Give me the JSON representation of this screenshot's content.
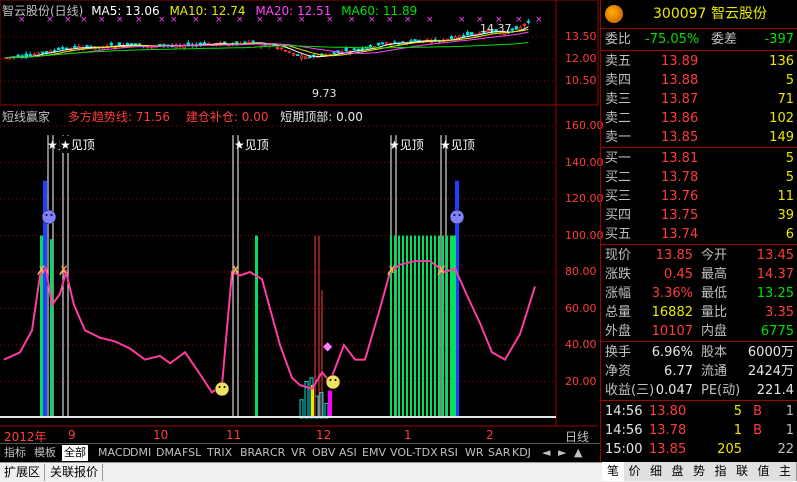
{
  "main_chart": {
    "title": "智云股份(日线)",
    "ma": [
      {
        "label": "MA5: 13.06",
        "color": "#ffffff"
      },
      {
        "label": "MA10: 12.74",
        "color": "#e8e800"
      },
      {
        "label": "MA20: 12.51",
        "color": "#ff44ff"
      },
      {
        "label": "MA60: 11.89",
        "color": "#00e000"
      }
    ],
    "y_ticks": [
      "13.50",
      "12.00",
      "10.50"
    ],
    "annotation_high": "14.37",
    "annotation_low": "9.73"
  },
  "indicator": {
    "name": "短线赢家",
    "lines": [
      {
        "label": "多方趋势线: 71.56",
        "color": "#ff3c3c"
      },
      {
        "label": "建仓补仓: 0.00",
        "color": "#ff3c3c"
      },
      {
        "label": "短期顶部: 0.00",
        "color": "#e6e6e6"
      }
    ],
    "y_ticks": [
      "160.00",
      "140.00",
      "120.00",
      "100.00",
      "80.00",
      "60.00",
      "40.00",
      "20.00"
    ],
    "top_labels": [
      "★见顶",
      "★见顶",
      "★见顶",
      "★见顶",
      "★见顶"
    ]
  },
  "time_axis": {
    "labels": [
      "2012年",
      "9",
      "10",
      "11",
      "12",
      "1",
      "2"
    ],
    "period": "日线"
  },
  "tabs": [
    "指标",
    "模板",
    "全部",
    "MACD",
    "DMI",
    "DMA",
    "FSL",
    "TRIX",
    "BRAR",
    "CR",
    "VR",
    "OBV",
    "ASI",
    "EMV",
    "VOL-TDX",
    "RSI",
    "WR",
    "SAR",
    "KDJ"
  ],
  "footer_tabs": [
    "扩展区",
    "关联报价"
  ],
  "quote": {
    "code": "300097",
    "name": "智云股份",
    "wei_bi_label": "委比",
    "wei_bi": "-75.05%",
    "wei_cha_label": "委差",
    "wei_cha": "-397",
    "asks": [
      {
        "label": "卖五",
        "price": "13.89",
        "vol": "136"
      },
      {
        "label": "卖四",
        "price": "13.88",
        "vol": "5"
      },
      {
        "label": "卖三",
        "price": "13.87",
        "vol": "71"
      },
      {
        "label": "卖二",
        "price": "13.86",
        "vol": "102"
      },
      {
        "label": "卖一",
        "price": "13.85",
        "vol": "149"
      }
    ],
    "bids": [
      {
        "label": "买一",
        "price": "13.81",
        "vol": "5"
      },
      {
        "label": "买二",
        "price": "13.78",
        "vol": "5"
      },
      {
        "label": "买三",
        "price": "13.76",
        "vol": "11"
      },
      {
        "label": "买四",
        "price": "13.75",
        "vol": "39"
      },
      {
        "label": "买五",
        "price": "13.74",
        "vol": "6"
      }
    ],
    "stats": [
      {
        "l1": "现价",
        "v1": "13.85",
        "c1": "red",
        "l2": "今开",
        "v2": "13.45",
        "c2": "red"
      },
      {
        "l1": "涨跌",
        "v1": "0.45",
        "c1": "red",
        "l2": "最高",
        "v2": "14.37",
        "c2": "red"
      },
      {
        "l1": "涨幅",
        "v1": "3.36%",
        "c1": "red",
        "l2": "最低",
        "v2": "13.25",
        "c2": "green"
      },
      {
        "l1": "总量",
        "v1": "16882",
        "c1": "yellow",
        "l2": "量比",
        "v2": "3.35",
        "c2": "red"
      },
      {
        "l1": "外盘",
        "v1": "10107",
        "c1": "red",
        "l2": "内盘",
        "v2": "6775",
        "c2": "green"
      }
    ],
    "stats2": [
      {
        "l1": "换手",
        "v1": "6.96%",
        "l2": "股本",
        "v2": "6000万"
      },
      {
        "l1": "净资",
        "v1": "6.77",
        "l2": "流通",
        "v2": "2424万"
      },
      {
        "l1": "收益(三)",
        "v1": "0.047",
        "l2": "PE(动)",
        "v2": "221.4"
      }
    ],
    "ticks": [
      {
        "time": "14:56",
        "price": "13.80",
        "vol": "5",
        "bs": "B",
        "n": "1"
      },
      {
        "time": "14:56",
        "price": "13.78",
        "vol": "1",
        "bs": "B",
        "n": "1"
      },
      {
        "time": "15:00",
        "price": "13.85",
        "vol": "205",
        "bs": "",
        "n": "22"
      }
    ],
    "side_tabs": [
      "笔",
      "价",
      "细",
      "盘",
      "势",
      "指",
      "联",
      "值",
      "主"
    ]
  }
}
